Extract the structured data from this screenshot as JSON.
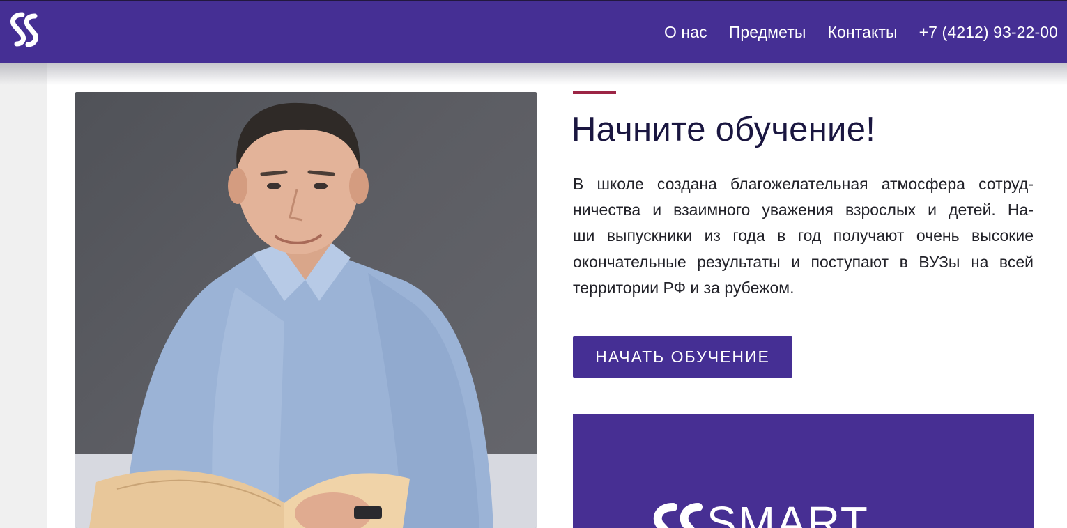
{
  "colors": {
    "brand": "#452f94",
    "accent": "#9c2545",
    "heading": "#1a1640"
  },
  "header": {
    "logo_icon": "ss-logo-icon",
    "nav": [
      {
        "label": "О нас"
      },
      {
        "label": "Предметы"
      },
      {
        "label": "Контакты"
      },
      {
        "label": "+7 (4212) 93-22-00"
      }
    ]
  },
  "hero": {
    "photo_icon": "teacher-portrait-photo",
    "title": "Начните обучение!",
    "paragraph_lines": [
      "В школе создана благожелательная атмосфера сотруд-",
      "ничества и взаимного уважения взрослых и детей. На-",
      "ши выпускники из года в год получают очень высокие",
      "окончательные результаты и поступают в ВУЗы на всей",
      "территории РФ и за рубежом."
    ],
    "cta_label": "НАЧАТЬ ОБУЧЕНИЕ"
  },
  "promo": {
    "logo_icon": "ss-logo-icon",
    "word": "SMART"
  }
}
